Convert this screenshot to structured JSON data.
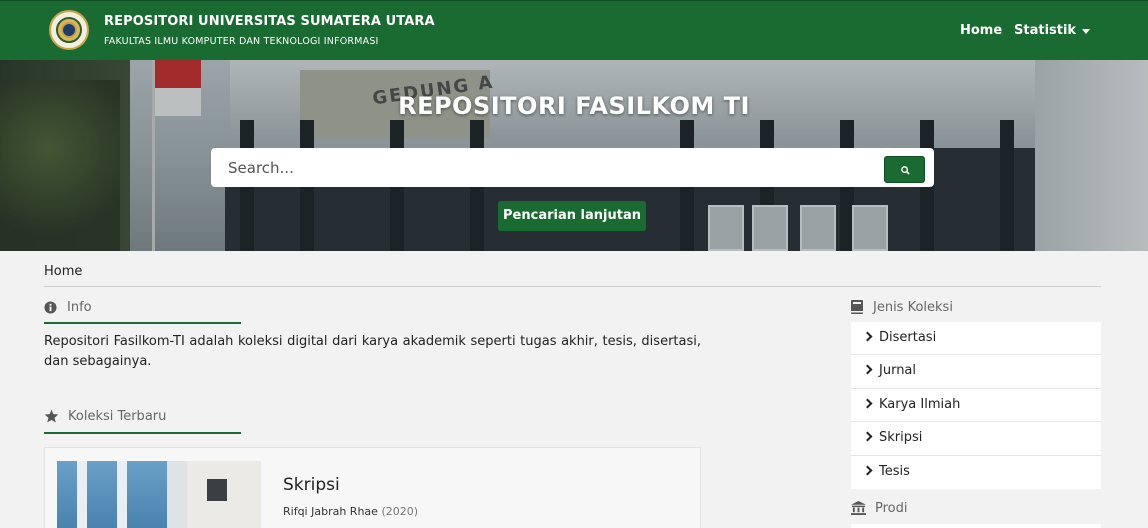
{
  "navbar": {
    "brand_title": "REPOSITORI UNIVERSITAS SUMATERA UTARA",
    "brand_subtitle": "FAKULTAS ILMU KOMPUTER DAN TEKNOLOGI INFORMASI",
    "links": [
      {
        "label": "Home"
      },
      {
        "label": "Statistik"
      }
    ],
    "brand_color": "#1a6b32"
  },
  "hero": {
    "title": "REPOSITORI FASILKOM TI",
    "search_placeholder": "Search...",
    "search_value": "",
    "advanced_search_label": "Pencarian lanjutan",
    "building_sign": "GEDUNG A"
  },
  "breadcrumb": {
    "home": "Home"
  },
  "info": {
    "heading": "Info",
    "icon": "info-circle-icon",
    "text": "Repositori Fasilkom-TI adalah koleksi digital dari karya akademik seperti tugas akhir, tesis, disertasi, dan sebagainya."
  },
  "latest": {
    "heading": "Koleksi Terbaru",
    "icon": "star-icon",
    "items": [
      {
        "type": "Skripsi",
        "author": "Rifqi Jabrah Rhae",
        "year": "(2020)"
      }
    ]
  },
  "sidebar": {
    "collection_heading": "Jenis Koleksi",
    "collection_icon": "book-icon",
    "items": [
      {
        "label": "Disertasi"
      },
      {
        "label": "Jurnal"
      },
      {
        "label": "Karya Ilmiah"
      },
      {
        "label": "Skripsi"
      },
      {
        "label": "Tesis"
      }
    ],
    "prodi_heading": "Prodi",
    "prodi_icon": "university-icon"
  }
}
